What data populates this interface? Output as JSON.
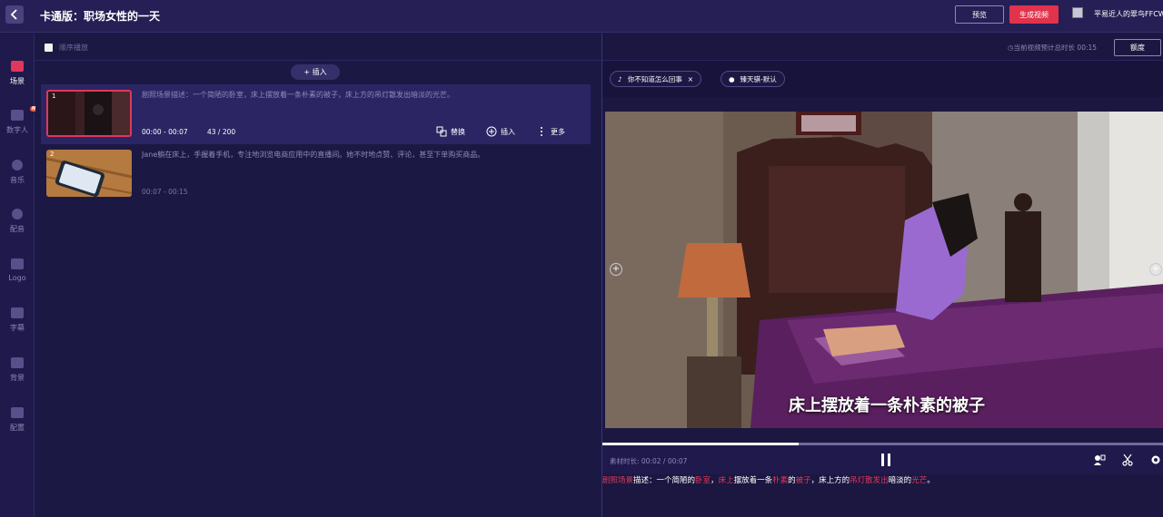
{
  "header": {
    "title": "卡通版：职场女性的一天",
    "preview_label": "预览",
    "generate_label": "生成视频",
    "user_name": "平易近人的翠鸟FFCW"
  },
  "sidebar": {
    "items": [
      {
        "label": "场景",
        "icon": "scene-icon",
        "active": true
      },
      {
        "label": "数字人",
        "icon": "avatar-person-icon",
        "badge": "NEW"
      },
      {
        "label": "音乐",
        "icon": "music-icon"
      },
      {
        "label": "配音",
        "icon": "microphone-icon"
      },
      {
        "label": "Logo",
        "icon": "logo-image-icon"
      },
      {
        "label": "字幕",
        "icon": "subtitle-icon"
      },
      {
        "label": "背景",
        "icon": "background-icon"
      },
      {
        "label": "配置",
        "icon": "settings-icon"
      }
    ]
  },
  "scenes_panel": {
    "sequential_play_label": "顺序播放",
    "insert_button": "+ 插入",
    "scenes": [
      {
        "index": "1",
        "description": "剧照场景描述：一个简陋的卧室，床上摆放着一条朴素的被子，床上方的吊灯散发出暗淡的光芒。",
        "time_range": "00:00 - 00:07",
        "char_count": "43 / 200",
        "actions": {
          "replace": "替换",
          "insert": "插入",
          "more": "更多"
        }
      },
      {
        "index": "2",
        "description": "Jane躺在床上，手握着手机，专注地浏览电商应用中的直播间。她不时地点赞、评论，甚至下单购买商品。",
        "time_range": "00:07 - 00:15"
      }
    ]
  },
  "preview_panel": {
    "total_duration_label": "当前视频预计总时长 00:15",
    "quota_button": "额度",
    "voice_chips": [
      {
        "label": "你不知道怎么回事",
        "icon": "music-note-icon",
        "closable": true
      },
      {
        "label": "臻天骐-默认",
        "icon": "microphone-icon",
        "closable": false
      }
    ],
    "subtitle_overlay": "床上摆放着一条朴素的被子",
    "progress_fraction": 0.35,
    "clip_duration_label": "素材时长: 00:02 / 00:07",
    "caption_segments": [
      {
        "text": "剧照场景",
        "highlight": true
      },
      {
        "text": "描述：一个简陋的",
        "highlight": false
      },
      {
        "text": "卧室",
        "highlight": true
      },
      {
        "text": "，",
        "highlight": false
      },
      {
        "text": "床上",
        "highlight": true
      },
      {
        "text": "摆放着一条",
        "highlight": false
      },
      {
        "text": "朴素",
        "highlight": true
      },
      {
        "text": "的",
        "highlight": false
      },
      {
        "text": "被子",
        "highlight": true
      },
      {
        "text": "，床上方的",
        "highlight": false
      },
      {
        "text": "吊灯散发出",
        "highlight": true
      },
      {
        "text": "暗淡的",
        "highlight": false
      },
      {
        "text": "光芒",
        "highlight": true
      },
      {
        "text": "。",
        "highlight": false
      }
    ]
  },
  "colors": {
    "accent": "#e0385b",
    "background": "#1c1844",
    "panel": "#251f55"
  }
}
